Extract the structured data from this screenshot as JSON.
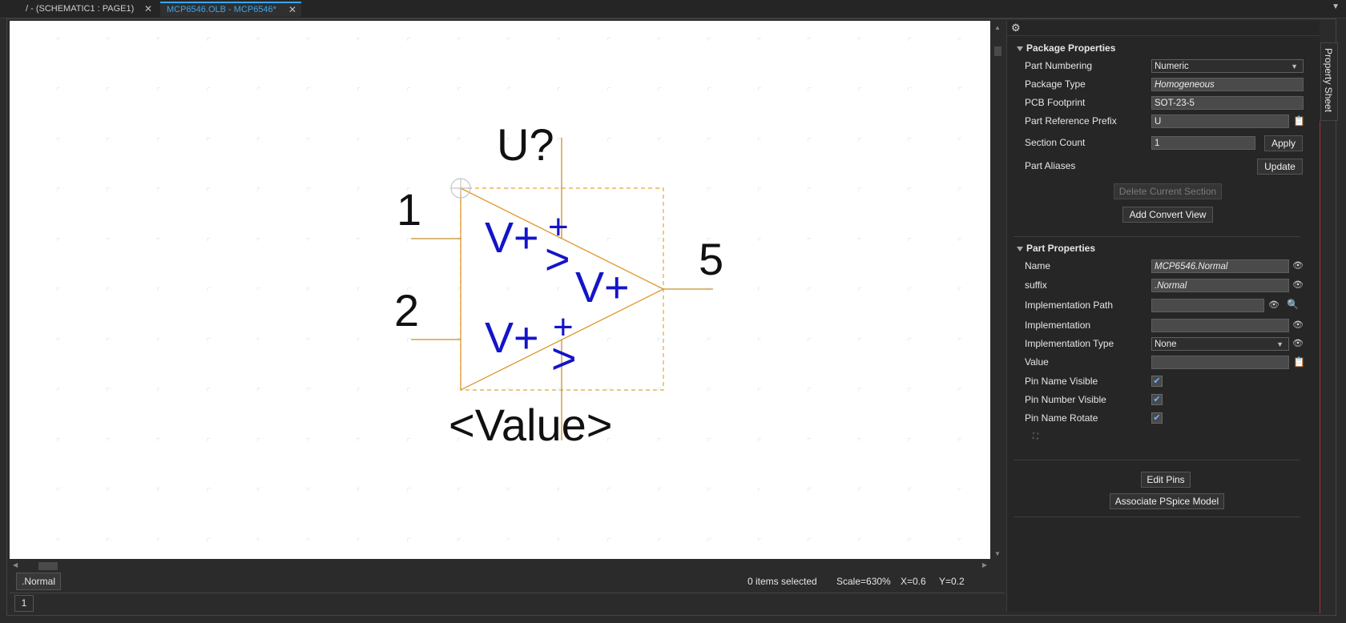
{
  "tabs": [
    {
      "label": "/ - (SCHEMATIC1 : PAGE1)",
      "close": "✕"
    },
    {
      "label": "MCP6546.OLB - MCP6546*",
      "close": "✕"
    }
  ],
  "tab_menu": "▼",
  "canvas": {
    "ref": "U?",
    "value": "<Value>",
    "pin1": "1",
    "pin2": "2",
    "pin5": "5",
    "vplus": "V+",
    "plus": "+",
    "gt": ">"
  },
  "status": {
    "view_tab": ".Normal",
    "items_selected": "0 items selected",
    "scale": "Scale=630%",
    "x": "X=0.6",
    "y": "Y=0.2",
    "page": "1"
  },
  "panel": {
    "vertical_tab": "Property Sheet",
    "package": {
      "title": "Package Properties",
      "part_numbering_label": "Part Numbering",
      "part_numbering_value": "Numeric",
      "package_type_label": "Package Type",
      "package_type_value": "Homogeneous",
      "pcb_footprint_label": "PCB Footprint",
      "pcb_footprint_value": "SOT-23-5",
      "ref_prefix_label": "Part Reference Prefix",
      "ref_prefix_value": "U",
      "section_count_label": "Section Count",
      "section_count_value": "1",
      "apply": "Apply",
      "aliases_label": "Part Aliases",
      "update": "Update",
      "delete_section": "Delete Current Section",
      "add_convert": "Add Convert View"
    },
    "part": {
      "title": "Part Properties",
      "name_label": "Name",
      "name_value": "MCP6546.Normal",
      "suffix_label": "suffix",
      "suffix_value": ".Normal",
      "impl_path_label": "Implementation Path",
      "impl_label": "Implementation",
      "impl_type_label": "Implementation Type",
      "impl_type_value": "None",
      "value_label": "Value",
      "pin_name_visible": "Pin Name Visible",
      "pin_number_visible": "Pin Number Visible",
      "pin_name_rotate": "Pin Name Rotate"
    },
    "edit_pins": "Edit Pins",
    "associate": "Associate PSpice Model"
  }
}
